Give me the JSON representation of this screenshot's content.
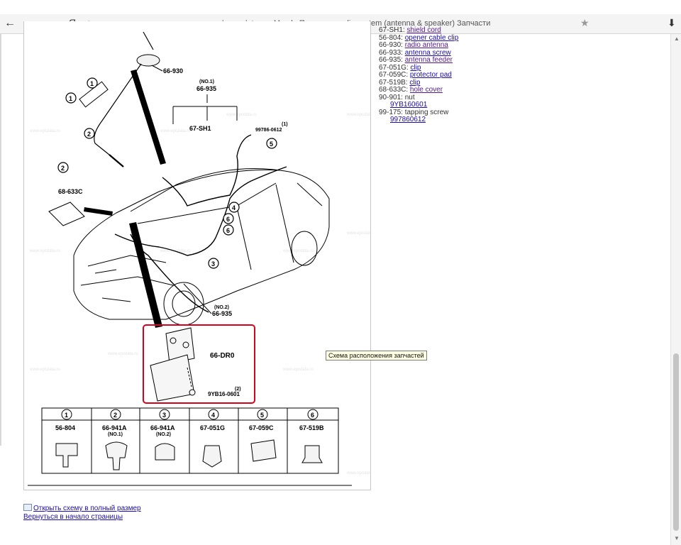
{
  "browser": {
    "back_glyph": "←",
    "ya_glyph": "Я",
    "reload_glyph": "c",
    "host": "mazda.epcdata.ru",
    "page_title": "Mazda Премаси: audio system (antenna & speaker) Запчасти",
    "star_glyph": "★",
    "download_glyph": "⬇"
  },
  "diagram": {
    "watermark": "www.epcdata.ru",
    "callouts": {
      "a66_930": "66-930",
      "no1": "(NO.1)",
      "a66_935_top": "66-935",
      "a67_sh1": "67-SH1",
      "a99786": "99786-0612",
      "one_qty": "(1)",
      "a68_633c": "68-633C",
      "no2": "(NO.2)",
      "a66_935_bot": "66-935",
      "a66_dr0": "66-DR0",
      "a9yb16": "9YB16-0601",
      "two_qty": "(2)"
    },
    "circled": [
      "1",
      "2",
      "3",
      "4",
      "5",
      "6"
    ],
    "legend": [
      {
        "num": "1",
        "code": "56-804",
        "sub": ""
      },
      {
        "num": "2",
        "code": "66-941A",
        "sub": "(NO.1)"
      },
      {
        "num": "3",
        "code": "66-941A",
        "sub": "(NO.2)"
      },
      {
        "num": "4",
        "code": "67-051G",
        "sub": ""
      },
      {
        "num": "5",
        "code": "67-059C",
        "sub": ""
      },
      {
        "num": "6",
        "code": "67-519B",
        "sub": ""
      }
    ]
  },
  "parts": [
    {
      "code": "67-SH1:",
      "name": "shield cord",
      "link": true,
      "visited": true
    },
    {
      "code": "56-804:",
      "name": "opener cable clip",
      "link": true,
      "visited": false
    },
    {
      "code": "66-930:",
      "name": "radio antenna",
      "link": true,
      "visited": true
    },
    {
      "code": "66-933:",
      "name": "antenna screw",
      "link": true,
      "visited": false
    },
    {
      "code": "66-935:",
      "name": "antenna feeder",
      "link": true,
      "visited": true
    },
    {
      "code": "67-051G:",
      "name": "clip",
      "link": true,
      "visited": false
    },
    {
      "code": "67-059C:",
      "name": "protector pad",
      "link": true,
      "visited": false
    },
    {
      "code": "67-519B:",
      "name": "clip",
      "link": true,
      "visited": false
    },
    {
      "code": "68-633C:",
      "name": "hole cover",
      "link": true,
      "visited": true
    },
    {
      "code": "90-901:",
      "name": "nut",
      "link": false,
      "visited": false
    },
    {
      "code": "",
      "name": "9YB160601",
      "link": true,
      "visited": false,
      "indent": true
    },
    {
      "code": "99-175:",
      "name": "tapping screw",
      "link": false,
      "visited": false
    },
    {
      "code": "",
      "name": "997860612",
      "link": true,
      "visited": false,
      "indent": true
    }
  ],
  "tooltip": "Схема расположения запчастей",
  "links": {
    "full_size": "Открыть схему в полный размер",
    "back_top": "Вернуться в начало страницы"
  },
  "scrollbar": {
    "up": "▲",
    "down": "▼"
  },
  "colors": {
    "highlight": "#d9001b",
    "link": "#1a0dab",
    "visited": "#551a8b"
  }
}
